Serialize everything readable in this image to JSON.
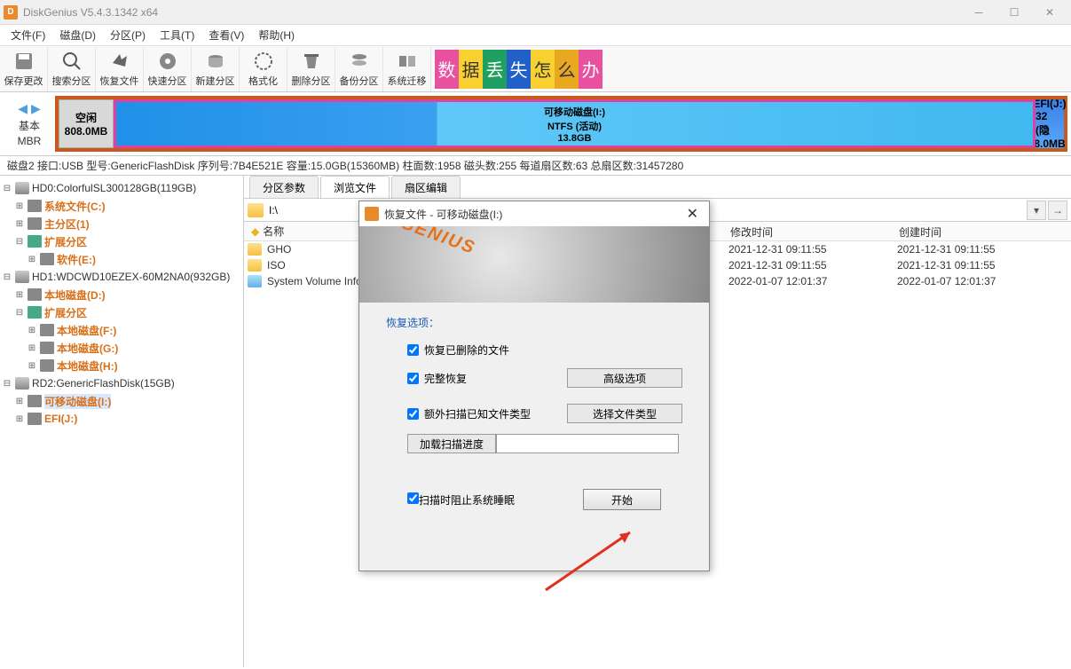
{
  "window": {
    "title": "DiskGenius V5.4.3.1342 x64"
  },
  "menu": [
    "文件(F)",
    "磁盘(D)",
    "分区(P)",
    "工具(T)",
    "查看(V)",
    "帮助(H)"
  ],
  "toolbar": [
    "保存更改",
    "搜索分区",
    "恢复文件",
    "快速分区",
    "新建分区",
    "格式化",
    "删除分区",
    "备份分区",
    "系统迁移"
  ],
  "banner": [
    "数",
    "据",
    "丢",
    "失",
    "怎",
    "么",
    "办"
  ],
  "diskmap": {
    "navtype": "基本",
    "navmbr": "MBR",
    "free_label": "空闲",
    "free_size": "808.0MB",
    "main_name": "可移动磁盘(I:)",
    "main_fs": "NTFS (活动)",
    "main_size": "13.8GB",
    "efi_name": "EFI(J:)",
    "efi_fs": "32 (隐",
    "efi_size": "8.0MB"
  },
  "infobar": "磁盘2  接口:USB  型号:GenericFlashDisk  序列号:7B4E521E  容量:15.0GB(15360MB)  柱面数:1958  磁头数:255  每道扇区数:63  总扇区数:31457280",
  "tree": {
    "d0": "HD0:ColorfulSL300128GB(119GB)",
    "d0p0": "系统文件(C:)",
    "d0p1": "主分区(1)",
    "d0ext": "扩展分区",
    "d0p2": "软件(E:)",
    "d1": "HD1:WDCWD10EZEX-60M2NA0(932GB)",
    "d1p0": "本地磁盘(D:)",
    "d1ext": "扩展分区",
    "d1p1": "本地磁盘(F:)",
    "d1p2": "本地磁盘(G:)",
    "d1p3": "本地磁盘(H:)",
    "d2": "RD2:GenericFlashDisk(15GB)",
    "d2p0": "可移动磁盘(I:)",
    "d2p1": "EFI(J:)"
  },
  "tabs": [
    "分区参数",
    "浏览文件",
    "扇区编辑"
  ],
  "path": "I:\\",
  "cols": {
    "name": "名称",
    "mtime": "修改时间",
    "ctime": "创建时间"
  },
  "files": [
    {
      "name": "GHO",
      "mtime": "2021-12-31 09:11:55",
      "ctime": "2021-12-31 09:11:55",
      "sys": false
    },
    {
      "name": "ISO",
      "mtime": "2021-12-31 09:11:55",
      "ctime": "2021-12-31 09:11:55",
      "sys": false
    },
    {
      "name": "System Volume Information",
      "mtime": "2022-01-07 12:01:37",
      "ctime": "2022-01-07 12:01:37",
      "sys": true
    }
  ],
  "dialog": {
    "title": "恢复文件 - 可移动磁盘(I:)",
    "brand": "DISKGENIUS",
    "optlabel": "恢复选项：",
    "opt1": "恢复已删除的文件",
    "opt2": "完整恢复",
    "btn_adv": "高级选项",
    "opt3": "额外扫描已知文件类型",
    "btn_types": "选择文件类型",
    "btn_load": "加载扫描进度",
    "opt4": "扫描时阻止系统睡眠",
    "btn_start": "开始"
  }
}
